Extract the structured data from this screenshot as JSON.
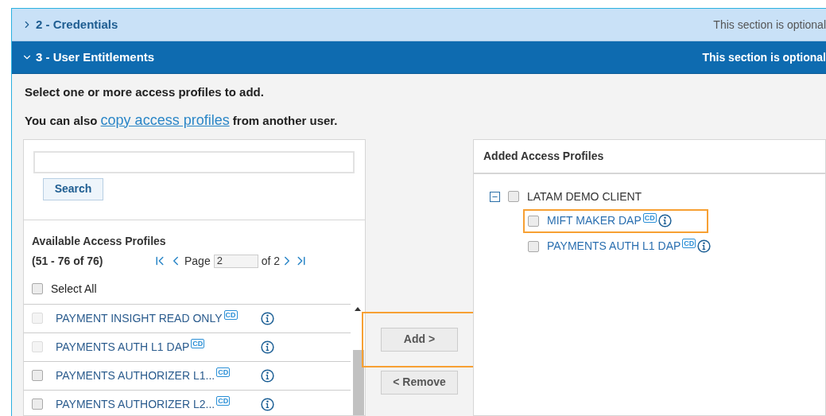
{
  "sections": [
    {
      "title": "2 - Credentials",
      "note": "This section is optional",
      "expanded": false
    },
    {
      "title": "3 - User Entitlements",
      "note": "This section is optional",
      "expanded": true
    }
  ],
  "intro": "Select one or more access profiles to add.",
  "copy_line": {
    "before": "You can also",
    "link": "copy access profiles",
    "after": "from another user."
  },
  "search": {
    "button": "Search"
  },
  "available": {
    "title": "Available Access Profiles",
    "range": "(51 - 76 of 76)",
    "page_label": "Page",
    "page": "2",
    "of": "of 2",
    "select_all": {
      "label": "Select All",
      "checked": false
    },
    "rows": [
      {
        "name": "PAYMENT INSIGHT READ ONLY",
        "badge": "CD",
        "checked": false,
        "disabled": true
      },
      {
        "name": "PAYMENTS AUTH L1 DAP",
        "badge": "CD",
        "checked": false,
        "disabled": true
      },
      {
        "name": "PAYMENTS AUTHORIZER L1...",
        "badge": "CD",
        "checked": false,
        "disabled": false
      },
      {
        "name": "PAYMENTS AUTHORIZER L2...",
        "badge": "CD",
        "checked": false,
        "disabled": false
      }
    ]
  },
  "actions": [
    {
      "label": "Add >",
      "highlighted": true
    },
    {
      "label": "< Remove",
      "highlighted": false
    }
  ],
  "added": {
    "title": "Added Access Profiles",
    "tree": [
      {
        "name": "LATAM DEMO CLIENT",
        "checked": false,
        "expanded": true,
        "children": [
          {
            "name": "MIFT MAKER DAP",
            "badge": "CD",
            "checked": false,
            "highlighted": true
          },
          {
            "name": "PAYMENTS AUTH L1 DAP",
            "badge": "CD",
            "checked": false,
            "highlighted": false
          }
        ]
      }
    ]
  }
}
